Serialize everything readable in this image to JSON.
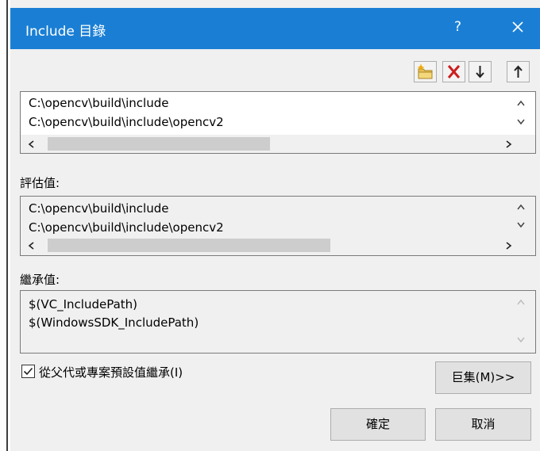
{
  "dialog": {
    "title": "Include 目錄",
    "help_label": "?"
  },
  "toolbar": {
    "icons": [
      "new-folder-icon",
      "delete-icon",
      "move-down-icon",
      "move-up-icon"
    ]
  },
  "editable_list": {
    "lines": [
      "C:\\opencv\\build\\include",
      "C:\\opencv\\build\\include\\opencv2"
    ]
  },
  "evaluated": {
    "label": "評估值:",
    "lines": [
      "C:\\opencv\\build\\include",
      "C:\\opencv\\build\\include\\opencv2"
    ]
  },
  "inherited": {
    "label": "繼承值:",
    "lines": [
      "$(VC_IncludePath)",
      "$(WindowsSDK_IncludePath)"
    ]
  },
  "inherit_checkbox": {
    "label": "從父代或專案預設值繼承(I)",
    "checked": true
  },
  "buttons": {
    "macros": "巨集(M)>>",
    "ok": "確定",
    "cancel": "取消"
  },
  "colors": {
    "titlebar": "#1a7fd4",
    "delete_red": "#cc1f1f"
  }
}
